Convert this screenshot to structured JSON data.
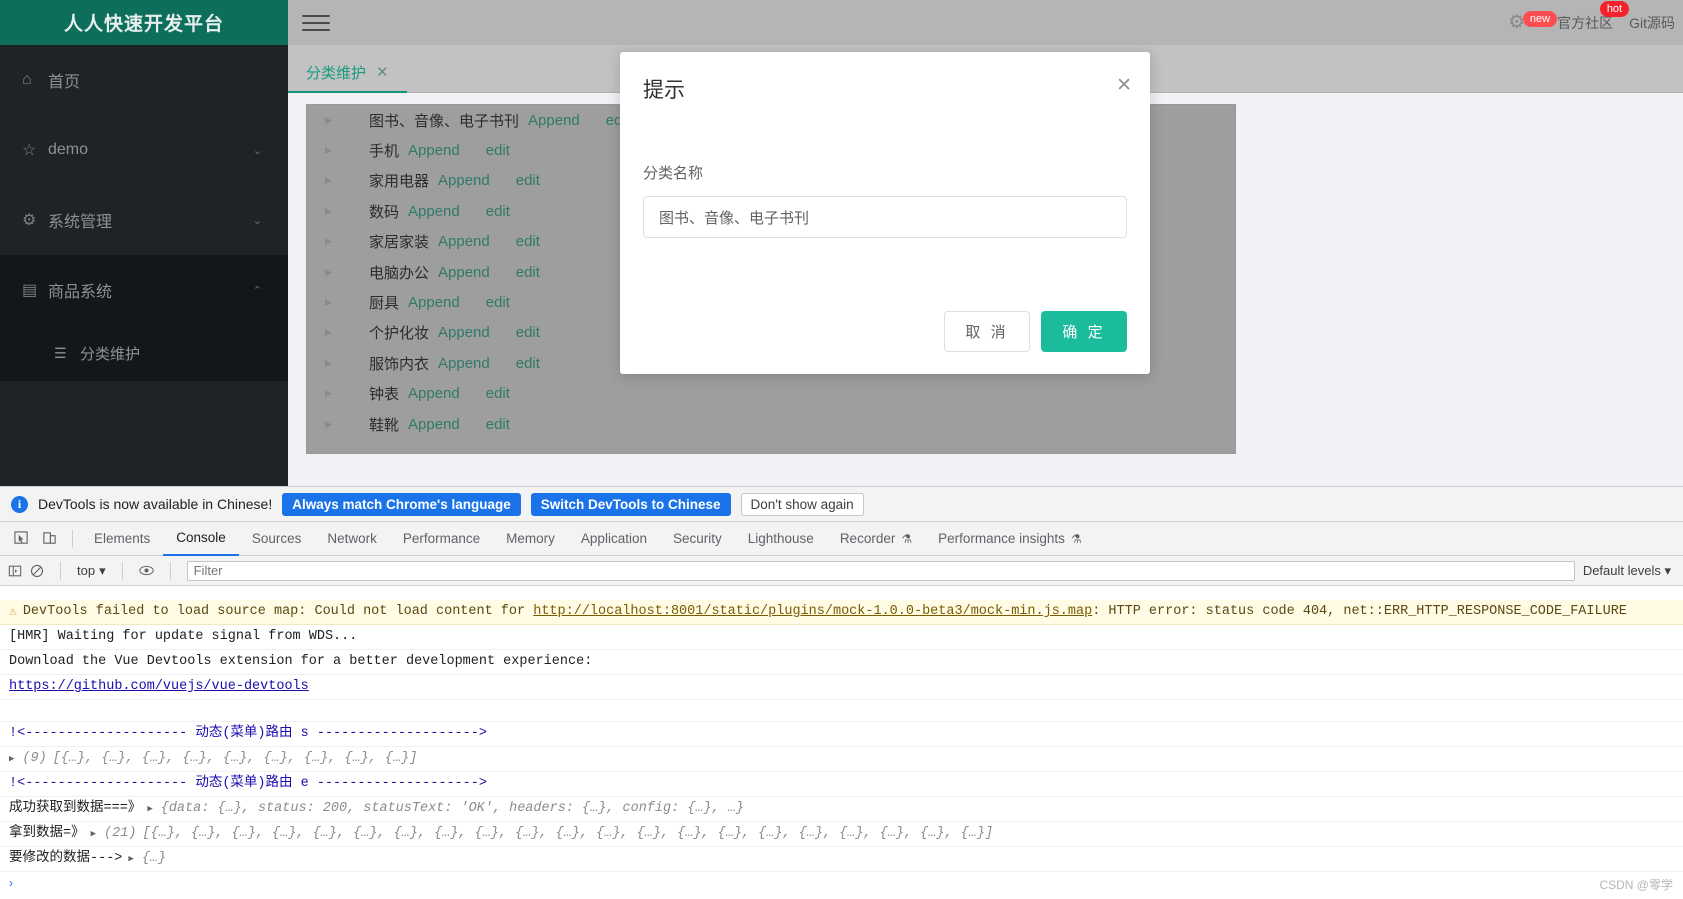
{
  "app": {
    "brand": "人人快速开发平台",
    "topbar": {
      "gear_icon": "gear-icon",
      "new_badge": "new",
      "community_label": "官方社区",
      "hot_badge": "hot",
      "git_label": "Git源码"
    },
    "sidebar": [
      {
        "icon": "home-icon",
        "glyph": "⌂",
        "label": "首页",
        "arrow": ""
      },
      {
        "icon": "star-icon",
        "glyph": "☆",
        "label": "demo",
        "arrow": "⌄"
      },
      {
        "icon": "gear-icon",
        "glyph": "⚙",
        "label": "系统管理",
        "arrow": "⌄"
      },
      {
        "icon": "window-icon",
        "glyph": "▤",
        "label": "商品系统",
        "arrow": "⌃"
      }
    ],
    "sidebar_sub": [
      {
        "icon": "list-icon",
        "glyph": "☰",
        "label": "分类维护"
      }
    ],
    "tab": {
      "label": "分类维护",
      "close": "✕"
    },
    "tree": {
      "append_label": "Append",
      "edit_label": "edit",
      "rows": [
        {
          "name": "图书、音像、电子书刊"
        },
        {
          "name": "手机"
        },
        {
          "name": "家用电器"
        },
        {
          "name": "数码"
        },
        {
          "name": "家居家装"
        },
        {
          "name": "电脑办公"
        },
        {
          "name": "厨具"
        },
        {
          "name": "个护化妆"
        },
        {
          "name": "服饰内衣"
        },
        {
          "name": "钟表"
        },
        {
          "name": "鞋靴"
        }
      ]
    },
    "dialog": {
      "title": "提示",
      "close": "✕",
      "field_label": "分类名称",
      "field_value": "图书、音像、电子书刊",
      "cancel": "取 消",
      "confirm": "确 定"
    }
  },
  "devtools": {
    "banner": {
      "text": "DevTools is now available in Chinese!",
      "info_icon": "info-icon",
      "btn_always": "Always match Chrome's language",
      "btn_switch": "Switch DevTools to Chinese",
      "btn_dismiss": "Don't show again"
    },
    "tabs": [
      {
        "label": "Elements",
        "active": false
      },
      {
        "label": "Console",
        "active": true
      },
      {
        "label": "Sources",
        "active": false
      },
      {
        "label": "Network",
        "active": false
      },
      {
        "label": "Performance",
        "active": false
      },
      {
        "label": "Memory",
        "active": false
      },
      {
        "label": "Application",
        "active": false
      },
      {
        "label": "Security",
        "active": false
      },
      {
        "label": "Lighthouse",
        "active": false
      },
      {
        "label": "Recorder",
        "active": false,
        "flask": "⚗"
      },
      {
        "label": "Performance insights",
        "active": false,
        "flask": "⚗"
      }
    ],
    "toolbar": {
      "sidebar_icon": "console-sidebar-icon",
      "clear_icon": "clear-console-icon",
      "context": "top",
      "context_caret": "▾",
      "eye_icon": "live-expression-icon",
      "filter_placeholder": "Filter",
      "filter_value": "",
      "levels": "Default levels ▾"
    },
    "console_rows": [
      {
        "kind": "warn",
        "icon": "warning-icon",
        "pre": "DevTools failed to load source map: Could not load content for ",
        "link": "http://localhost:8001/static/plugins/mock-1.0.0-beta3/mock-min.js.map",
        "post": ": HTTP error: status code 404, net::ERR_HTTP_RESPONSE_CODE_FAILURE"
      },
      {
        "kind": "plain",
        "text": "[HMR] Waiting for update signal from WDS..."
      },
      {
        "kind": "plain",
        "text": "Download the Vue Devtools extension for a better development experience:"
      },
      {
        "kind": "link",
        "text": "https://github.com/vuejs/vue-devtools"
      },
      {
        "kind": "blank",
        "text": ""
      },
      {
        "kind": "route",
        "text": "!<-------------------- 动态(菜单)路由 s -------------------->",
        "mid": "动态(菜单)路由 s"
      },
      {
        "kind": "array",
        "count": "(9)",
        "text": "[{…}, {…}, {…}, {…}, {…}, {…}, {…}, {…}, {…}]"
      },
      {
        "kind": "route",
        "text": "!<-------------------- 动态(菜单)路由 e -------------------->",
        "mid": "动态(菜单)路由 e"
      },
      {
        "kind": "object",
        "label": "成功获取到数据===》",
        "text": "{data: {…}, status: 200, statusText: 'OK', headers: {…}, config: {…}, …}"
      },
      {
        "kind": "array2",
        "label": "拿到数据=》",
        "count": "(21)",
        "text": "[{…}, {…}, {…}, {…}, {…}, {…}, {…}, {…}, {…}, {…}, {…}, {…}, {…}, {…}, {…}, {…}, {…}, {…}, {…}, {…}, {…}]"
      },
      {
        "kind": "object2",
        "label": "要修改的数据--->",
        "text": "{…}"
      }
    ],
    "prompt": "›"
  },
  "watermark": "CSDN @零学",
  "colors": {
    "brand_green": "#0e6e5c",
    "accent_teal": "#1bbc9b",
    "sidebar_dark": "#1f2326",
    "link_blue": "#1a73e8"
  }
}
